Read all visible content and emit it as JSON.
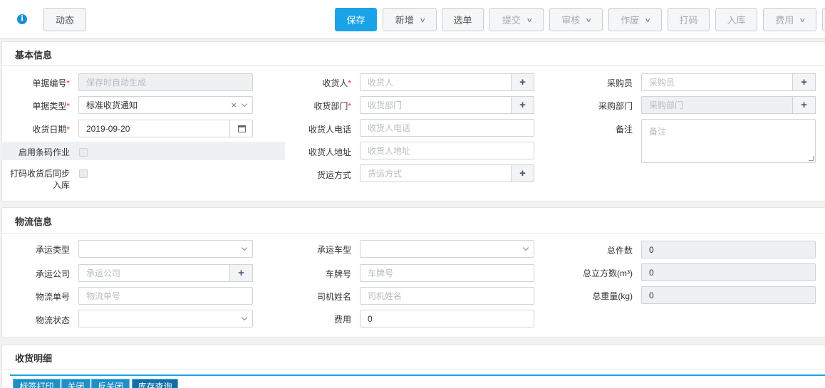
{
  "toolbar": {
    "dynamic_label": "动态",
    "save_label": "保存",
    "new_label": "新增",
    "select_label": "选单",
    "submit_label": "提交",
    "review_label": "审核",
    "void_label": "作废",
    "print_code_label": "打码",
    "stock_in_label": "入库",
    "cost_label": "费用"
  },
  "basic": {
    "title": "基本信息",
    "doc_no": {
      "label": "单据编号",
      "placeholder": "保存时自动生成"
    },
    "doc_type": {
      "label": "单据类型",
      "value": "标准收货通知"
    },
    "recv_date": {
      "label": "收货日期",
      "value": "2019-09-20"
    },
    "barcode_op": {
      "label": "启用条码作业"
    },
    "sync_stock_in": {
      "label_line1": "打码收货后同步",
      "label_line2": "入库"
    },
    "receiver": {
      "label": "收货人",
      "placeholder": "收货人"
    },
    "recv_dept": {
      "label": "收货部门",
      "placeholder": "收货部门"
    },
    "receiver_phone": {
      "label": "收货人电话",
      "placeholder": "收货人电话"
    },
    "receiver_addr": {
      "label": "收货人地址",
      "placeholder": "收货人地址"
    },
    "ship_method": {
      "label": "货运方式",
      "placeholder": "货运方式"
    },
    "buyer": {
      "label": "采购员",
      "placeholder": "采购员"
    },
    "purchase_dept": {
      "label": "采购部门",
      "placeholder": "采购部门"
    },
    "remark": {
      "label": "备注",
      "placeholder": "备注"
    }
  },
  "logistics": {
    "title": "物流信息",
    "carrier_type": {
      "label": "承运类型"
    },
    "carrier_company": {
      "label": "承运公司",
      "placeholder": "承运公司"
    },
    "tracking_no": {
      "label": "物流单号",
      "placeholder": "物流单号"
    },
    "logistics_status": {
      "label": "物流状态"
    },
    "vehicle_type": {
      "label": "承运车型"
    },
    "plate_no": {
      "label": "车牌号",
      "placeholder": "车牌号"
    },
    "driver_name": {
      "label": "司机姓名",
      "placeholder": "司机姓名"
    },
    "fee": {
      "label": "费用",
      "value": "0"
    },
    "total_pieces": {
      "label": "总件数",
      "value": "0"
    },
    "total_volume": {
      "label": "总立方数(m³)",
      "value": "0"
    },
    "total_weight": {
      "label": "总重量(kg)",
      "value": "0"
    }
  },
  "detail": {
    "title": "收货明细",
    "tabs": [
      "标签打印",
      "关闭",
      "反关闭",
      "库存查询"
    ]
  },
  "colors": {
    "primary": "#1aa3e8",
    "required": "#e33333"
  }
}
